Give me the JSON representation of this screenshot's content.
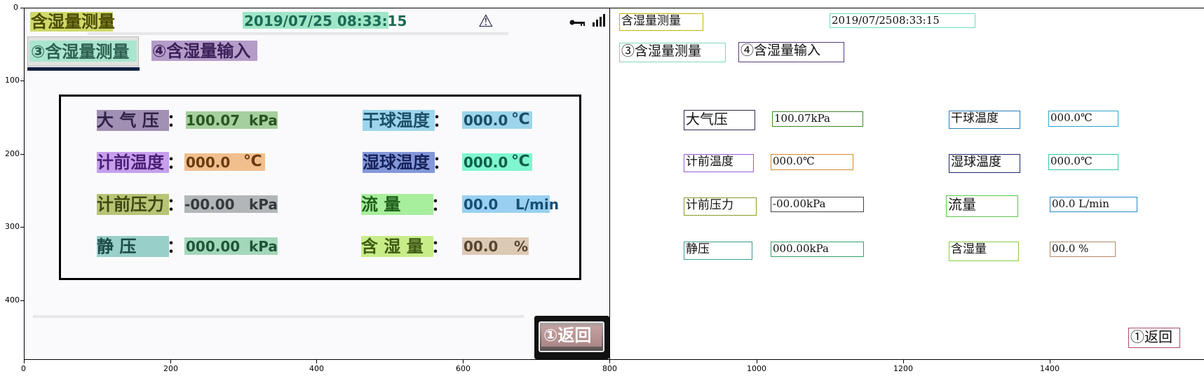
{
  "plot": {
    "xticks": [
      "0",
      "200",
      "400",
      "600",
      "800",
      "1000",
      "1200",
      "1400"
    ],
    "yticks": [
      "0",
      "100",
      "200",
      "300",
      "400"
    ]
  },
  "hmi": {
    "title": "含湿量测量",
    "datetime": "2019/07/25 08:33:15",
    "warning_icon": "⚠",
    "tab_measure": "③含湿量测量",
    "tab_input": "④含湿量输入",
    "return_button": "①返回",
    "fields": {
      "atm_label": "大 气 压",
      "atm_value": "100.07",
      "atm_unit": "kPa",
      "dry_label": "干球温度",
      "dry_value": "000.0",
      "dry_unit": "℃",
      "pre_temp_label": "计前温度",
      "pre_temp_value": "000.0",
      "pre_temp_unit": "℃",
      "wet_label": "湿球温度",
      "wet_value": "000.0",
      "wet_unit": "℃",
      "pre_press_label": "计前压力",
      "pre_press_value": "-00.00",
      "pre_press_unit": "kPa",
      "flow_label": "流      量",
      "flow_value": "00.0",
      "flow_unit": "L/min",
      "static_label": "静      压",
      "static_value": "000.00",
      "static_unit": "kPa",
      "moist_label": "含  湿  量",
      "moist_value": "00.0",
      "moist_unit": "%"
    },
    "colon": "："
  },
  "annotations": {
    "title": "含湿量测量",
    "datetime": "2019/07/2508:33:15",
    "tab_measure": "③含湿量测量",
    "tab_input": "④含湿量输入",
    "atm_label": "大气压",
    "atm_value": "100.07kPa",
    "dry_label": "干球温度",
    "dry_value": "000.0℃",
    "pre_temp_label": "计前温度",
    "pre_temp_value": "000.0℃",
    "wet_label": "湿球温度",
    "wet_value": "000.0℃",
    "pre_press_label": "计前压力",
    "pre_press_value": "-00.00kPa",
    "flow_label": "流量",
    "flow_value": "00.0 L/min",
    "static_label": "静压",
    "static_value": "000.00kPa",
    "moist_label": "含湿量",
    "moist_value": "00.0 %",
    "return_button": "①返回"
  }
}
